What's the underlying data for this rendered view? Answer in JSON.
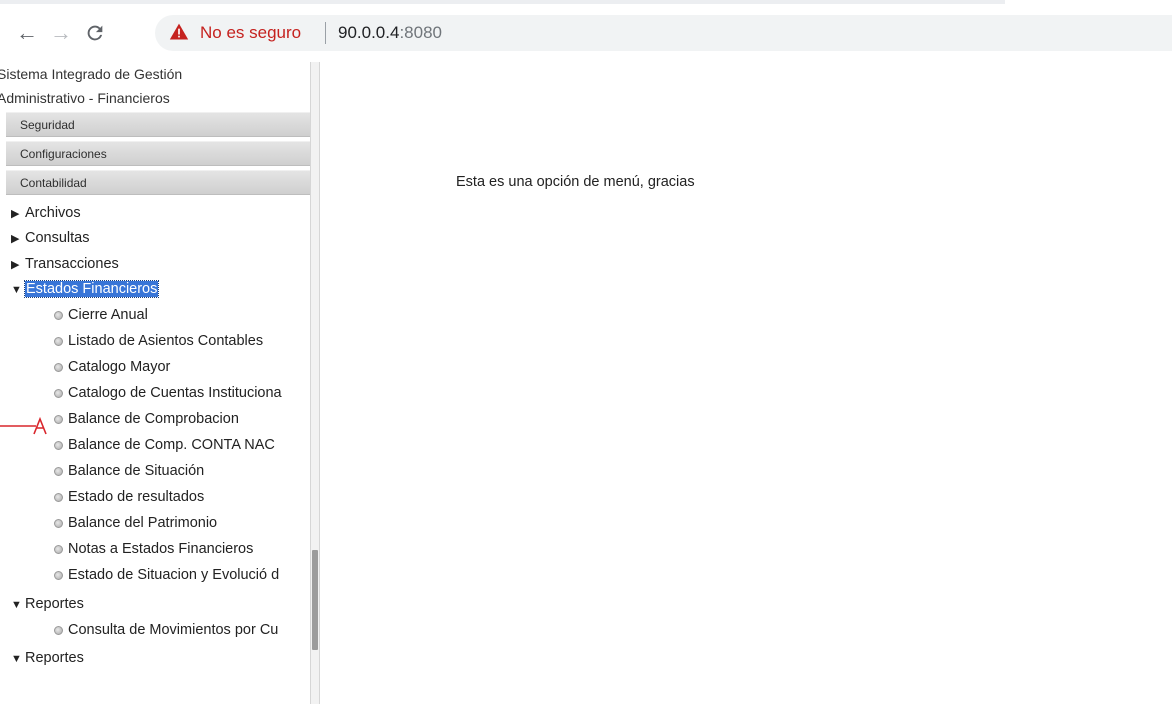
{
  "browser": {
    "security_label": "No es seguro",
    "url_host": "90.0.0.4",
    "url_port": ":8080"
  },
  "sidebar": {
    "app_title_line1": "Sistema Integrado de Gestión",
    "app_title_line2": "Administrativo - Financieros",
    "sections": [
      "Seguridad",
      "Configuraciones",
      "Contabilidad"
    ],
    "tree": {
      "archivos": "Archivos",
      "consultas": "Consultas",
      "transacciones": "Transacciones",
      "estados_financieros": "Estados Financieros",
      "estados_items": [
        "Cierre Anual",
        "Listado de Asientos Contables",
        "Catalogo Mayor",
        "Catalogo de Cuentas Instituciona",
        "Balance de Comprobacion",
        "Balance de Comp. CONTA NAC",
        "Balance de Situación",
        "Estado de resultados",
        "Balance del Patrimonio",
        "Notas a Estados Financieros",
        "Estado de Situacion y Evolució d"
      ],
      "reportes_1": "Reportes",
      "reportes_items": [
        "Consulta de Movimientos por Cu"
      ],
      "reportes_2": "Reportes"
    },
    "annotation_letter": "A",
    "annotation_color": "#d9262c",
    "selected_color": "#3875d7"
  },
  "main": {
    "message": "Esta es una opción de menú, gracias"
  }
}
